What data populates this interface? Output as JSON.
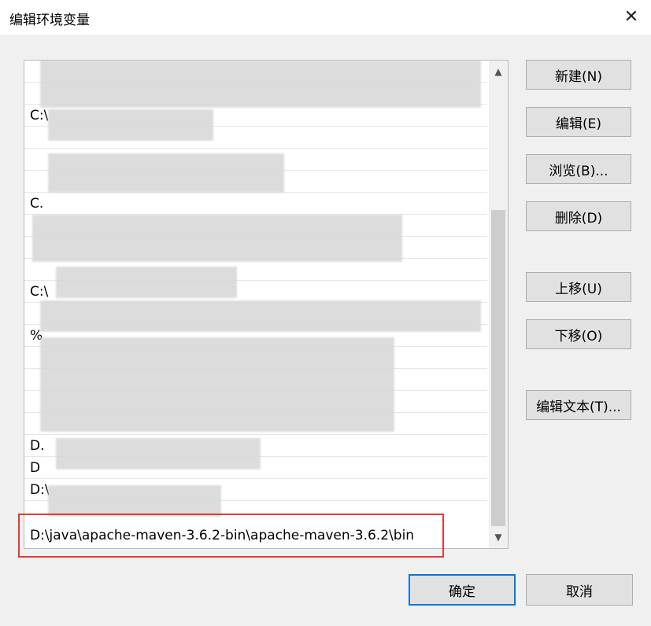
{
  "title": "编辑环境变量",
  "close_glyph": "✕",
  "list": {
    "visible_fragments": [
      "C:\\",
      "C.",
      "C:\\",
      "%",
      "D.",
      "D",
      "D:\\"
    ],
    "selected_item": "D:\\java\\apache-maven-3.6.2-bin\\apache-maven-3.6.2\\bin"
  },
  "buttons": {
    "new": "新建(N)",
    "edit": "编辑(E)",
    "browse": "浏览(B)...",
    "delete": "删除(D)",
    "move_up": "上移(U)",
    "move_down": "下移(O)",
    "edit_text": "编辑文本(T)...",
    "ok": "确定",
    "cancel": "取消"
  },
  "colors": {
    "highlight_border": "#e53935",
    "primary_border": "#0078d7"
  }
}
